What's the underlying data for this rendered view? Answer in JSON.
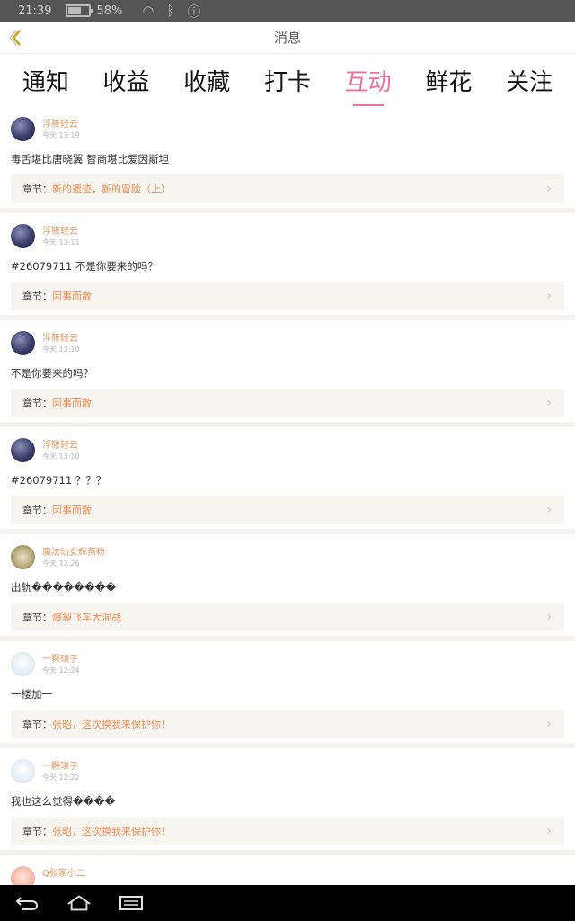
{
  "status_bar": {
    "time": "21:39",
    "battery": "58%",
    "battery_level": 0.58
  },
  "header": {
    "title": "消息",
    "back_icon": "chevron-left-icon"
  },
  "tabs": [
    {
      "label": "通知",
      "active": false
    },
    {
      "label": "收益",
      "active": false
    },
    {
      "label": "收藏",
      "active": false
    },
    {
      "label": "打卡",
      "active": false
    },
    {
      "label": "互动",
      "active": true
    },
    {
      "label": "鲜花",
      "active": false
    },
    {
      "label": "关注",
      "active": false
    }
  ],
  "chapter_label": "章节：",
  "colors": {
    "accent": "#e8739a",
    "username": "#e39a62",
    "chapter_link": "#ef8a55"
  },
  "messages": [
    {
      "user": "浮筱轻云",
      "time": "今天 13:19",
      "text": "毒舌堪比唐晓翼 智商堪比爱因斯坦",
      "chapter": "新的遗迹，新的冒险（上）"
    },
    {
      "user": "浮筱轻云",
      "time": "今天 13:11",
      "text": "#26079711 不是你要来的吗？",
      "chapter": "因事而散"
    },
    {
      "user": "浮筱轻云",
      "time": "今天 13:10",
      "text": "不是你要来的吗？",
      "chapter": "因事而散"
    },
    {
      "user": "浮筱轻云",
      "time": "今天 13:10",
      "text": "#26079711 ？？？",
      "chapter": "因事而散"
    },
    {
      "user": "魔法仙女辉燕粉",
      "time": "今天 12:26",
      "text": "出轨��������",
      "chapter": "爆裂飞车大混战"
    },
    {
      "user": "一颗琪子",
      "time": "今天 12:24",
      "text": "一楼加一",
      "chapter": "张昭，这次换我来保护你！"
    },
    {
      "user": "一颗琪子",
      "time": "今天 12:22",
      "text": "我也这么觉得����",
      "chapter": "张昭，这次换我来保护你！"
    },
    {
      "user": "Q张家小二"
    }
  ]
}
